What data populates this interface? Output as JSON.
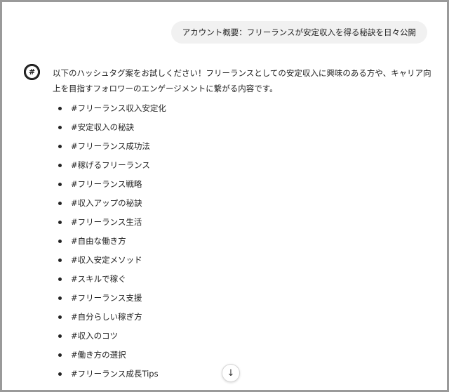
{
  "user_message": "アカウント概要：フリーランスが安定収入を得る秘訣を日々公開",
  "assistant": {
    "intro": "以下のハッシュタグ案をお試しください！フリーランスとしての安定収入に興味のある方や、キャリア向上を目指すフォロワーのエンゲージメントに繋がる内容です。",
    "tags": [
      "#フリーランス収入安定化",
      "#安定収入の秘訣",
      "#フリーランス成功法",
      "#稼げるフリーランス",
      "#フリーランス戦略",
      "#収入アップの秘訣",
      "#フリーランス生活",
      "#自由な働き方",
      "#収入安定メソッド",
      "#スキルで稼ぐ",
      "#フリーランス支援",
      "#自分らしい稼ぎ方",
      "#収入のコツ",
      "#働き方の選択",
      "#フリーランス成長Tips"
    ]
  },
  "icons": {
    "avatar": "assistant-logo-icon",
    "scroll": "arrow-down-icon"
  }
}
